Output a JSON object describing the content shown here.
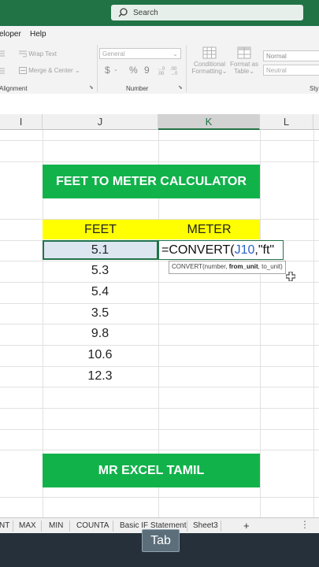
{
  "search": {
    "label": "Search"
  },
  "menu": {
    "items": [
      "eloper",
      "Help"
    ]
  },
  "ribbon": {
    "wrap_text": "Wrap Text",
    "merge_center": "Merge & Center",
    "alignment_label": "Alignment",
    "number_format": "General",
    "number_label": "Number",
    "currency_symbol": "$",
    "percent_symbol": "%",
    "comma_symbol": "9",
    "conditional_formatting_1": "Conditional",
    "conditional_formatting_2": "Formatting",
    "format_as_table_1": "Format as",
    "format_as_table_2": "Table",
    "style_normal": "Normal",
    "style_neutral": "Neutral",
    "styles_label": "Styl"
  },
  "columns": [
    "I",
    "J",
    "K",
    "L"
  ],
  "sheet": {
    "title": "FEET TO METER CALCULATOR",
    "header_feet": "FEET",
    "header_meter": "METER",
    "feet_values": [
      "5.1",
      "5.3",
      "5.4",
      "3.5",
      "9.8",
      "10.6",
      "12.3"
    ],
    "formula_prefix": "=CONVERT(",
    "formula_ref": "J10",
    "formula_suffix": ",\"ft\"",
    "tooltip_start": "CONVERT(number, ",
    "tooltip_bold": "from_unit",
    "tooltip_end": ", to_unit)",
    "footer": "MR EXCEL TAMIL"
  },
  "tabs": [
    "NT",
    "MAX",
    "MIN",
    "COUNTA",
    "Basic IF Statement",
    "Sheet3",
    "+"
  ],
  "key_overlay": "Tab",
  "colors": {
    "excel_green": "#217346",
    "banner_green": "#12b24b",
    "header_yellow": "#ffff00"
  }
}
